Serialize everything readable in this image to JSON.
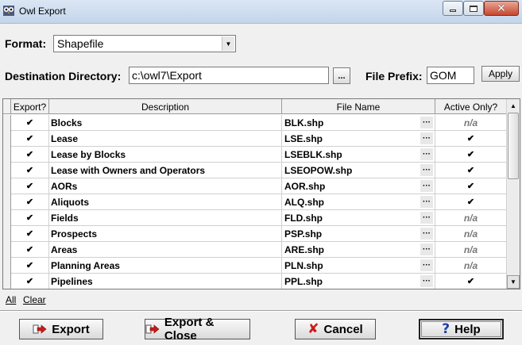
{
  "window": {
    "title": "Owl Export"
  },
  "format": {
    "label": "Format:",
    "value": "Shapefile"
  },
  "destination": {
    "label": "Destination Directory:",
    "value": "c:\\owl7\\Export",
    "browse_label": "..."
  },
  "file_prefix": {
    "label": "File Prefix:",
    "value": "GOM",
    "apply_label": "Apply"
  },
  "table": {
    "columns": [
      "Export?",
      "Description",
      "File Name",
      "Active Only?"
    ],
    "dots_label": "···",
    "rows": [
      {
        "export": true,
        "description": "Blocks",
        "file": "BLK.shp",
        "active": "n/a"
      },
      {
        "export": true,
        "description": "Lease",
        "file": "LSE.shp",
        "active": "checked"
      },
      {
        "export": true,
        "description": "Lease by Blocks",
        "file": "LSEBLK.shp",
        "active": "checked"
      },
      {
        "export": true,
        "description": "Lease with Owners and Operators",
        "file": "LSEOPOW.shp",
        "active": "checked"
      },
      {
        "export": true,
        "description": "AORs",
        "file": "AOR.shp",
        "active": "checked"
      },
      {
        "export": true,
        "description": "Aliquots",
        "file": "ALQ.shp",
        "active": "checked"
      },
      {
        "export": true,
        "description": "Fields",
        "file": "FLD.shp",
        "active": "n/a"
      },
      {
        "export": true,
        "description": "Prospects",
        "file": "PSP.shp",
        "active": "n/a"
      },
      {
        "export": true,
        "description": "Areas",
        "file": "ARE.shp",
        "active": "n/a"
      },
      {
        "export": true,
        "description": "Planning Areas",
        "file": "PLN.shp",
        "active": "n/a"
      },
      {
        "export": true,
        "description": "Pipelines",
        "file": "PPL.shp",
        "active": "checked"
      }
    ]
  },
  "links": {
    "all": "All",
    "clear": "Clear"
  },
  "buttons": {
    "export": "Export",
    "export_close": "Export & Close",
    "cancel": "Cancel",
    "help": "Help"
  },
  "colors": {
    "accent_red": "#cc1a1a",
    "help_blue": "#1b3fa8",
    "titlebar": "#c4d5ea"
  }
}
